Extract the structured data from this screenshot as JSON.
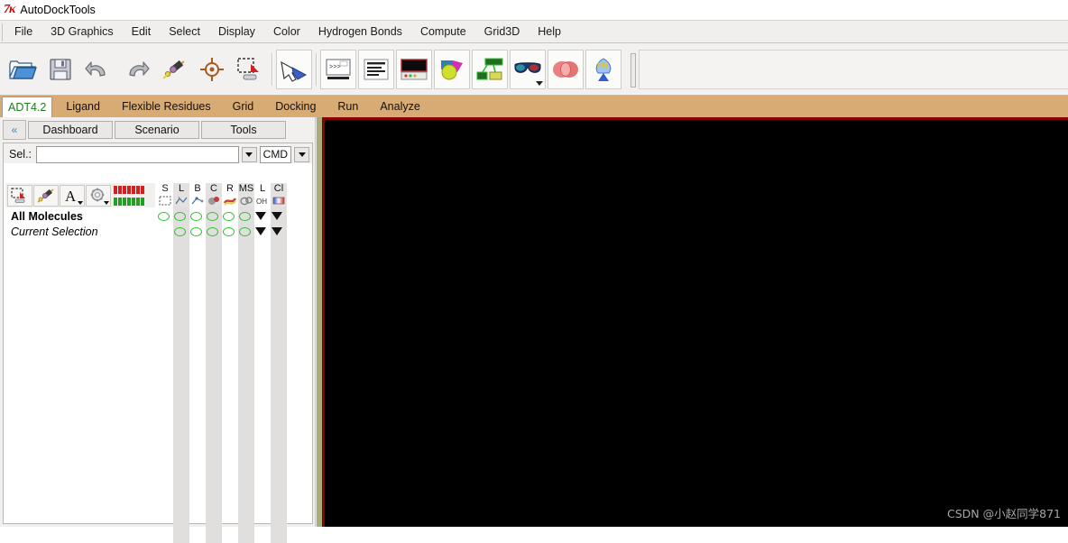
{
  "window": {
    "title": "AutoDockTools",
    "logo_icon": "tk-python-icon"
  },
  "menubar": {
    "items": [
      {
        "label": "File"
      },
      {
        "label": "3D Graphics"
      },
      {
        "label": "Edit"
      },
      {
        "label": "Select"
      },
      {
        "label": "Display"
      },
      {
        "label": "Color"
      },
      {
        "label": "Hydrogen Bonds"
      },
      {
        "label": "Compute"
      },
      {
        "label": "Grid3D"
      },
      {
        "label": "Help"
      }
    ]
  },
  "toolbar": {
    "buttons": [
      {
        "name": "open-folder-icon"
      },
      {
        "name": "save-floppy-icon"
      },
      {
        "name": "undo-icon"
      },
      {
        "name": "redo-icon"
      },
      {
        "name": "molecule-bond-icon"
      },
      {
        "name": "center-target-icon"
      },
      {
        "name": "selection-to-object-icon"
      },
      {
        "name": "pointer-hand-icon"
      },
      {
        "name": "python-shell-icon"
      },
      {
        "name": "text-lines-icon"
      },
      {
        "name": "display-screen-icon"
      },
      {
        "name": "color-sphere-icon"
      },
      {
        "name": "network-graph-icon"
      },
      {
        "name": "stereo-glasses-icon"
      },
      {
        "name": "anaglyph-stereo-icon"
      },
      {
        "name": "flexible-residues-icon"
      }
    ]
  },
  "module_tabs": {
    "items": [
      {
        "label": "ADT4.2",
        "active": true
      },
      {
        "label": "Ligand",
        "active": false
      },
      {
        "label": "Flexible Residues",
        "active": false
      },
      {
        "label": "Grid",
        "active": false
      },
      {
        "label": "Docking",
        "active": false
      },
      {
        "label": "Run",
        "active": false
      },
      {
        "label": "Analyze",
        "active": false
      }
    ]
  },
  "dashboard": {
    "collapse_label": "«",
    "nav_buttons": [
      {
        "label": "Dashboard"
      },
      {
        "label": "Scenario"
      },
      {
        "label": "Tools"
      }
    ],
    "selection": {
      "label": "Sel.:",
      "value": "",
      "placeholder": "",
      "mode": "CMD"
    },
    "icon_tools": [
      {
        "name": "selection-tool-icon"
      },
      {
        "name": "molecule-tool-icon"
      },
      {
        "name": "label-text-icon"
      },
      {
        "name": "gear-settings-icon"
      },
      {
        "name": "sequence-bar-icon"
      }
    ],
    "columns": [
      {
        "label": "S",
        "icon": "marquee-select-icon"
      },
      {
        "label": "L",
        "icon": "lines-representation-icon"
      },
      {
        "label": "B",
        "icon": "ball-stick-icon"
      },
      {
        "label": "C",
        "icon": "cpk-spheres-icon"
      },
      {
        "label": "R",
        "icon": "ribbon-icon"
      },
      {
        "label": "MS",
        "icon": "molecular-surface-icon"
      },
      {
        "label": "L",
        "icon": "hydroxyl-label-icon"
      },
      {
        "label": "Cl",
        "icon": "color-ramp-icon"
      }
    ],
    "rows": [
      {
        "label": "All Molecules",
        "style": "bold",
        "cells": [
          "circle",
          "circle",
          "circle",
          "circle",
          "circle",
          "circle",
          "triangle",
          "triangle"
        ]
      },
      {
        "label": "Current Selection",
        "style": "italic",
        "cells": [
          "empty",
          "circle",
          "circle",
          "circle",
          "circle",
          "circle",
          "triangle",
          "triangle"
        ]
      }
    ]
  },
  "viewport": {
    "background": "#000000",
    "border_color": "#8b0000",
    "watermark": "CSDN @小赵同学871"
  },
  "colors": {
    "module_bar": "#d9ab74",
    "active_tab_text": "#1f7a1f",
    "toggle_green": "#2fbf2f",
    "sash": "#a9ad7a"
  }
}
